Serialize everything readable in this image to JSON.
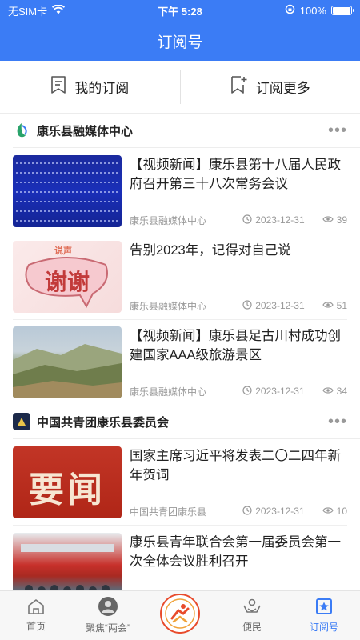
{
  "status": {
    "carrier": "无SIM卡",
    "time": "下午 5:28",
    "battery": "100%",
    "battery_level": 1.0
  },
  "header": {
    "title": "订阅号"
  },
  "subscribe_bar": {
    "my_subs": "我的订阅",
    "more_subs": "订阅更多"
  },
  "channels": [
    {
      "name": "康乐县融媒体中心",
      "articles": [
        {
          "title": "【视频新闻】康乐县第十八届人民政府召开第三十八次常务会议",
          "source": "康乐县融媒体中心",
          "date": "2023-12-31",
          "views": "39"
        },
        {
          "title": "告别2023年，记得对自己说",
          "source": "康乐县融媒体中心",
          "date": "2023-12-31",
          "views": "51",
          "thumb_small": "说声",
          "thumb_big": "谢谢"
        },
        {
          "title": "【视频新闻】康乐县足古川村成功创建国家AAA级旅游景区",
          "source": "康乐县融媒体中心",
          "date": "2023-12-31",
          "views": "34"
        }
      ]
    },
    {
      "name": "中国共青团康乐县委员会",
      "articles": [
        {
          "title": "国家主席习近平将发表二〇二四年新年贺词",
          "source": "中国共青团康乐县",
          "date": "2023-12-31",
          "views": "10",
          "thumb_big": "要闻"
        },
        {
          "title": "康乐县青年联合会第一届委员会第一次全体会议胜利召开",
          "source": "",
          "date": "",
          "views": ""
        }
      ]
    }
  ],
  "tabs": [
    {
      "label": "首页",
      "icon": "home-icon"
    },
    {
      "label": "聚焦“两会”",
      "icon": "avatar-icon"
    },
    {
      "label": "",
      "icon": "center-logo"
    },
    {
      "label": "便民",
      "icon": "hands-icon"
    },
    {
      "label": "订阅号",
      "icon": "subscription-icon"
    }
  ],
  "colors": {
    "primary": "#3b7cf5",
    "accent_red": "#e84b2c"
  }
}
